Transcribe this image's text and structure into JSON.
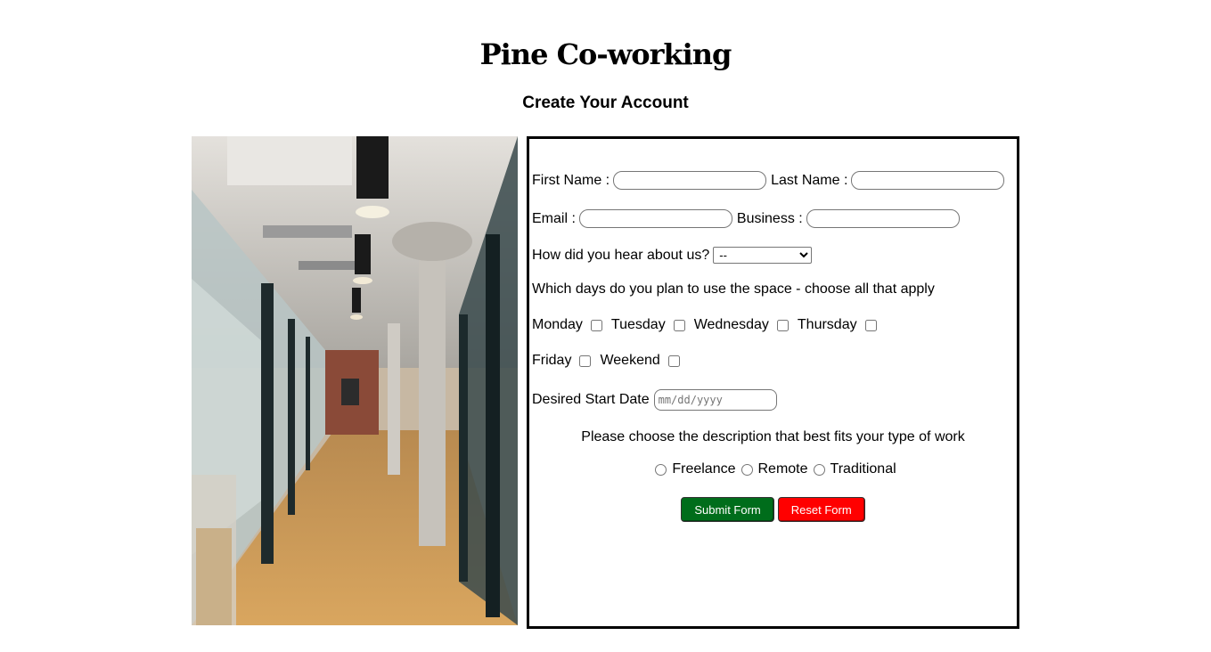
{
  "header": {
    "title": "Pine Co-working",
    "subtitle": "Create Your Account"
  },
  "form": {
    "first_name_label": "First Name :",
    "last_name_label": "Last Name :",
    "email_label": "Email :",
    "business_label": "Business :",
    "hear_label": "How did you hear about us?",
    "hear_selected": "--",
    "days_prompt": "Which days do you plan to use the space - choose all that apply",
    "days": {
      "monday": "Monday",
      "tuesday": "Tuesday",
      "wednesday": "Wednesday",
      "thursday": "Thursday",
      "friday": "Friday",
      "weekend": "Weekend"
    },
    "start_date_label": "Desired Start Date",
    "start_date_placeholder": "mm/dd/yyyy",
    "work_prompt": "Please choose the description that best fits your type of work",
    "work_types": {
      "freelance": "Freelance",
      "remote": "Remote",
      "traditional": "Traditional"
    },
    "submit_label": "Submit Form",
    "reset_label": "Reset Form"
  },
  "colors": {
    "submit_bg": "#006d1b",
    "reset_bg": "#ff0000",
    "border": "#000000"
  }
}
